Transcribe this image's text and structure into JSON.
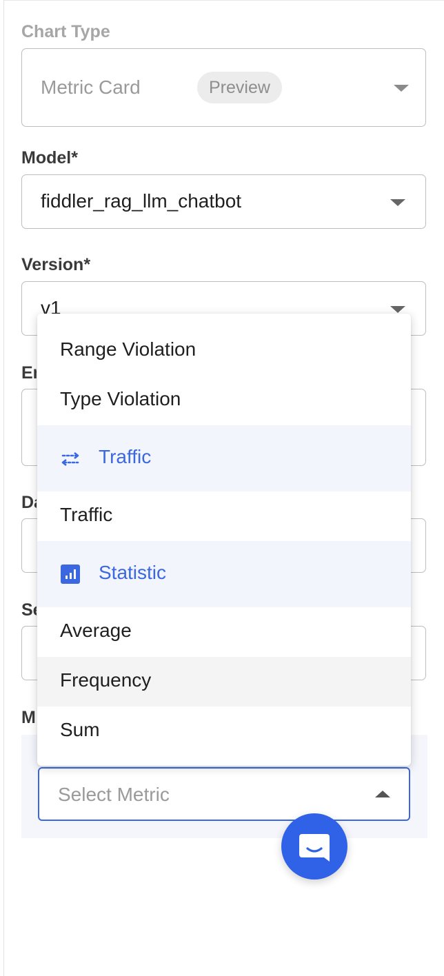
{
  "chart_type": {
    "label": "Chart Type",
    "value": "Metric Card",
    "badge": "Preview"
  },
  "model": {
    "label": "Model*",
    "value": "fiddler_rag_llm_chatbot"
  },
  "version": {
    "label": "Version*",
    "value": "v1"
  },
  "partial_labels": {
    "environment": "En",
    "dataset": "Da",
    "segment": "Se",
    "metric": "M"
  },
  "metric": {
    "placeholder": "Select Metric"
  },
  "dropdown": {
    "items": [
      {
        "kind": "option",
        "label": "Range Violation"
      },
      {
        "kind": "option",
        "label": "Type Violation"
      },
      {
        "kind": "group",
        "label": "Traffic",
        "icon": "arrows-swap-icon"
      },
      {
        "kind": "option",
        "label": "Traffic"
      },
      {
        "kind": "group",
        "label": "Statistic",
        "icon": "bar-chart-icon"
      },
      {
        "kind": "option",
        "label": "Average"
      },
      {
        "kind": "option",
        "label": "Frequency",
        "hovered": true
      },
      {
        "kind": "option",
        "label": "Sum"
      }
    ]
  },
  "chat": {
    "icon": "chat-bubble-icon"
  },
  "colors": {
    "accent": "#3b68e0",
    "group_bg": "#f3f5fc",
    "fab": "#2f62e6"
  }
}
